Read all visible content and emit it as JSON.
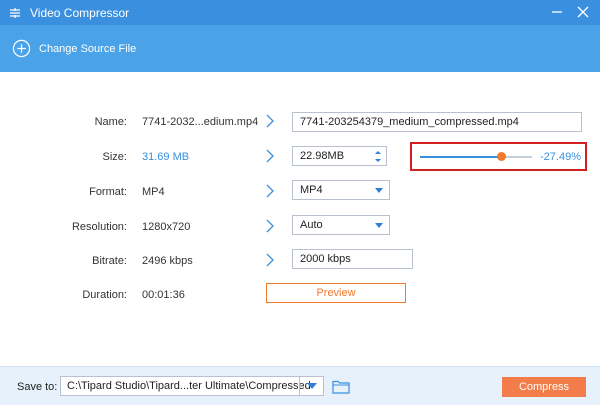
{
  "window": {
    "title": "Video Compressor"
  },
  "toolbar": {
    "change_source_label": "Change Source File"
  },
  "rows": {
    "name": {
      "label": "Name:",
      "value": "7741-2032...edium.mp4",
      "output": "7741-203254379_medium_compressed.mp4"
    },
    "size": {
      "label": "Size:",
      "value": "31.69 MB",
      "output": "22.98MB",
      "slider_percent_label": "-27.49%",
      "slider_fraction": 0.7251
    },
    "format": {
      "label": "Format:",
      "value": "MP4",
      "output": "MP4"
    },
    "resolution": {
      "label": "Resolution:",
      "value": "1280x720",
      "output": "Auto"
    },
    "bitrate": {
      "label": "Bitrate:",
      "value": "2496 kbps",
      "output": "2000 kbps"
    },
    "duration": {
      "label": "Duration:",
      "value": "00:01:36"
    }
  },
  "preview_label": "Preview",
  "footer": {
    "save_to_label": "Save to:",
    "path": "C:\\Tipard Studio\\Tipard...ter Ultimate\\Compressed",
    "compress_label": "Compress"
  },
  "colors": {
    "accent": "#3a8fde",
    "toolbar": "#4aa3e8",
    "orange": "#f07a2c",
    "highlight": "#d21f1f"
  },
  "icons": [
    "app-icon",
    "minimize-icon",
    "close-icon",
    "plus-circle-icon",
    "chevron-right-icon",
    "spinner-arrows-icon",
    "dropdown-arrow-icon",
    "folder-icon"
  ]
}
